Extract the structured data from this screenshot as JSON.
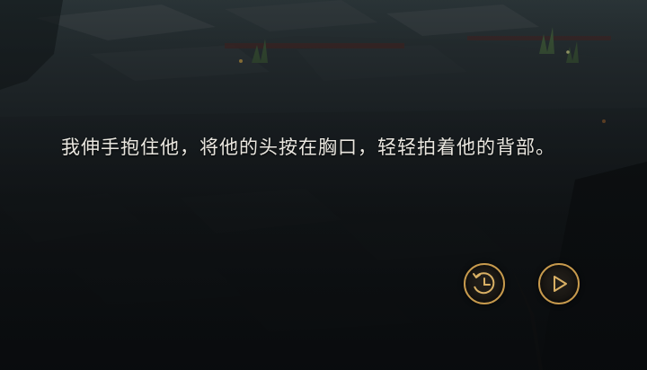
{
  "dialogue": {
    "text": "我伸手抱住他，将他的头按在胸口，轻轻拍着他的背部。"
  },
  "controls": {
    "history_icon": "history-clock-icon",
    "play_icon": "play-triangle-icon",
    "accent_color": "#c79a4d"
  }
}
